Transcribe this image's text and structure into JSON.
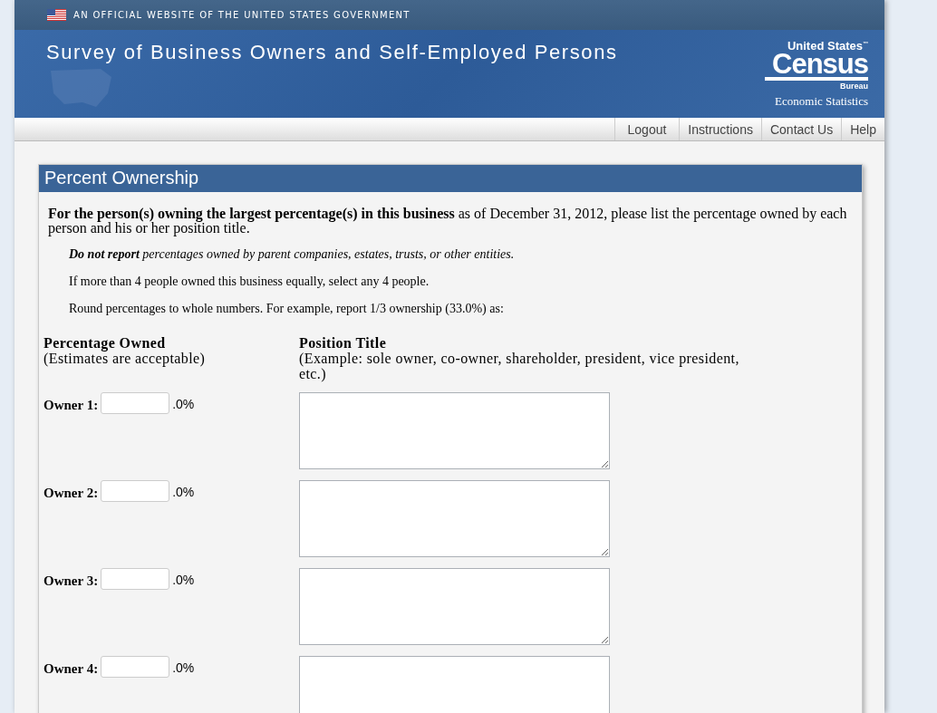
{
  "gov_banner": {
    "text": "AN OFFICIAL WEBSITE OF THE UNITED STATES GOVERNMENT"
  },
  "header": {
    "title": "Survey of Business Owners and Self-Employed Persons",
    "logo": {
      "top": "United States",
      "main": "Census",
      "sub": "Bureau",
      "tm": "™"
    },
    "subtitle": "Economic Statistics"
  },
  "nav": [
    "Logout",
    "Instructions",
    "Contact Us",
    "Help"
  ],
  "panel": {
    "title": "Percent Ownership",
    "intro": "**For the person(s) owning the largest percentage(s) in this business** as of December 31, 2012, please list the percentage owned by each person and his or her position title.",
    "notes": [
      {
        "kind": "italic",
        "text": "**Do not report** percentages owned by parent companies, estates, trusts, or other entities."
      },
      {
        "kind": "plain",
        "text": "If more than 4 people owned this business equally, select any 4 people."
      },
      {
        "kind": "plain",
        "text": "Round percentages to whole numbers. For example, report 1/3 ownership (33.0%) as:"
      }
    ],
    "columns": [
      {
        "heading": "Percentage Owned",
        "hint": "(Estimates are acceptable)"
      },
      {
        "heading": "Position Title",
        "hint": "(Example: sole owner, co-owner, shareholder, president, vice president, etc.)"
      }
    ],
    "owners": [
      {
        "label": "Owner 1:",
        "suffix": ".0%"
      },
      {
        "label": "Owner 2:",
        "suffix": ".0%"
      },
      {
        "label": "Owner 3:",
        "suffix": ".0%"
      },
      {
        "label": "Owner 4:",
        "suffix": ".0%"
      }
    ]
  }
}
